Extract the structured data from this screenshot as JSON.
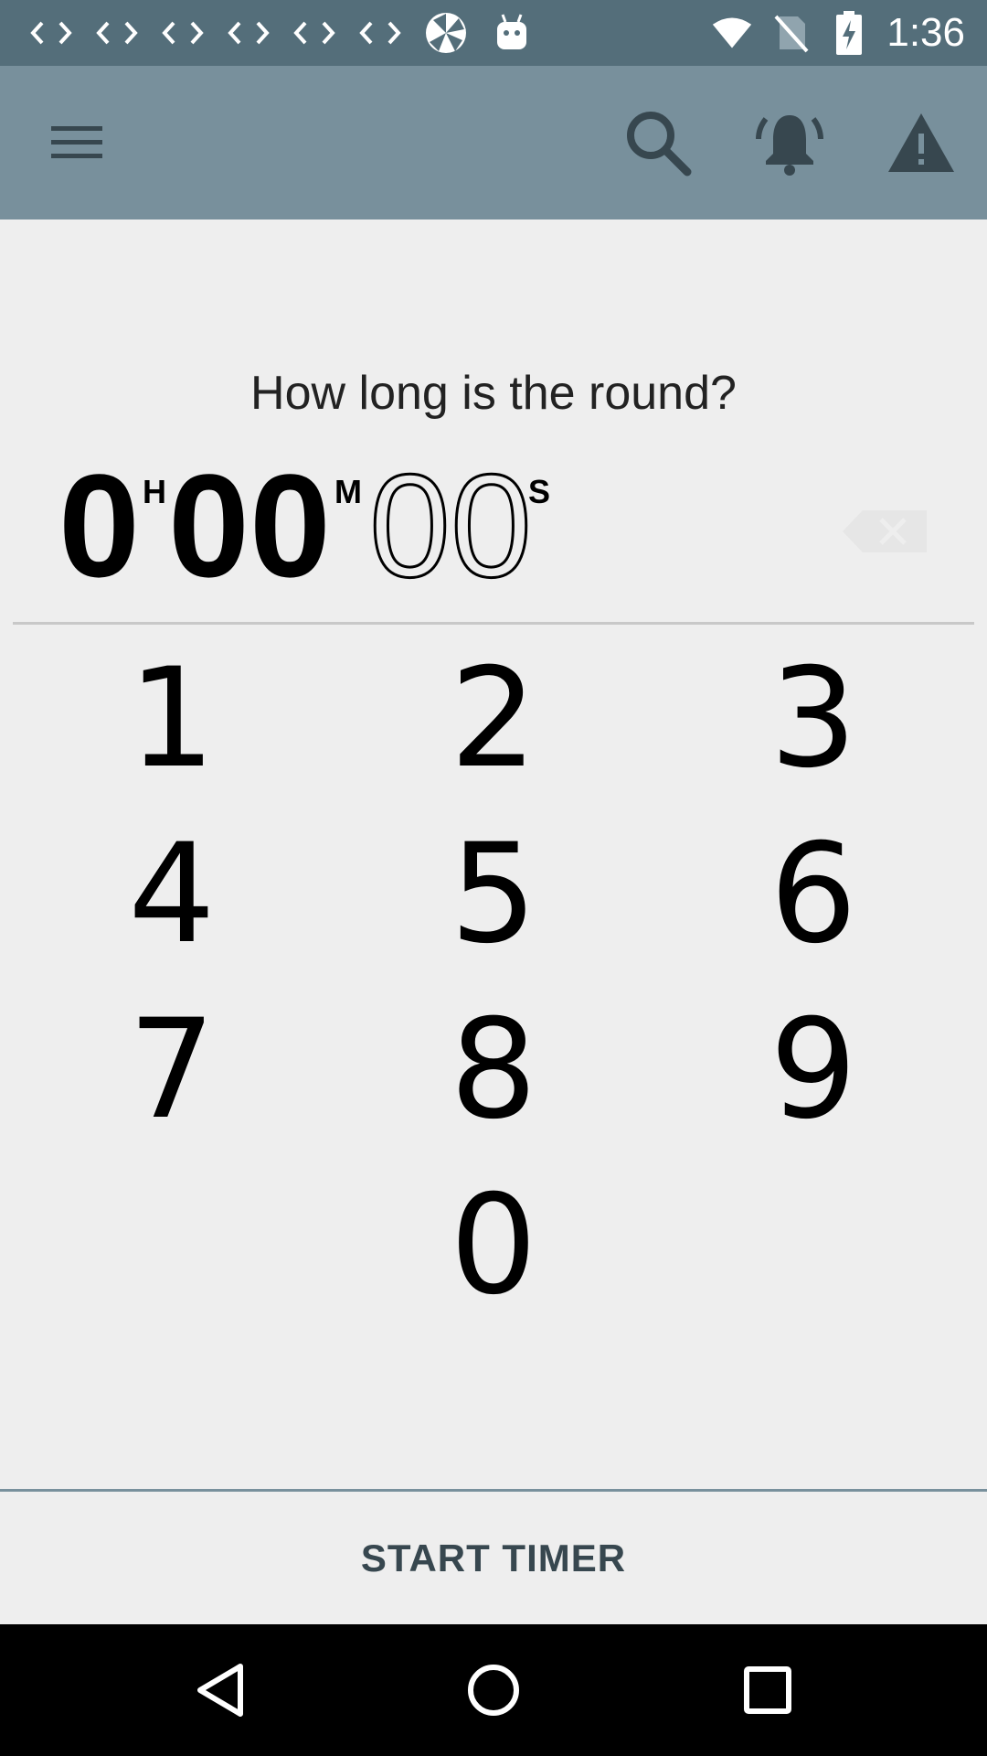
{
  "status_bar": {
    "time": "1:36",
    "left_icons": [
      "code-icon",
      "code-icon",
      "code-icon",
      "code-icon",
      "code-icon",
      "code-icon",
      "pinwheel-icon",
      "android-icon"
    ],
    "right_icons": [
      "wifi-icon",
      "no-sim-icon",
      "battery-charging-icon"
    ]
  },
  "app_bar": {
    "background": "#78909c",
    "actions": [
      "menu-icon",
      "search-icon",
      "bell-icon",
      "warning-icon"
    ]
  },
  "prompt": "How long is the round?",
  "timer": {
    "hours": "0",
    "hours_unit": "H",
    "minutes": "00",
    "minutes_unit": "M",
    "seconds": "00",
    "seconds_unit": "S"
  },
  "keypad": {
    "k1": "1",
    "k2": "2",
    "k3": "3",
    "k4": "4",
    "k5": "5",
    "k6": "6",
    "k7": "7",
    "k8": "8",
    "k9": "9",
    "k0": "0"
  },
  "start_button": "START TIMER",
  "colors": {
    "status_bar": "#546e7a",
    "app_bar": "#78909c",
    "background": "#eeeeee",
    "accent_text": "#37474f"
  }
}
